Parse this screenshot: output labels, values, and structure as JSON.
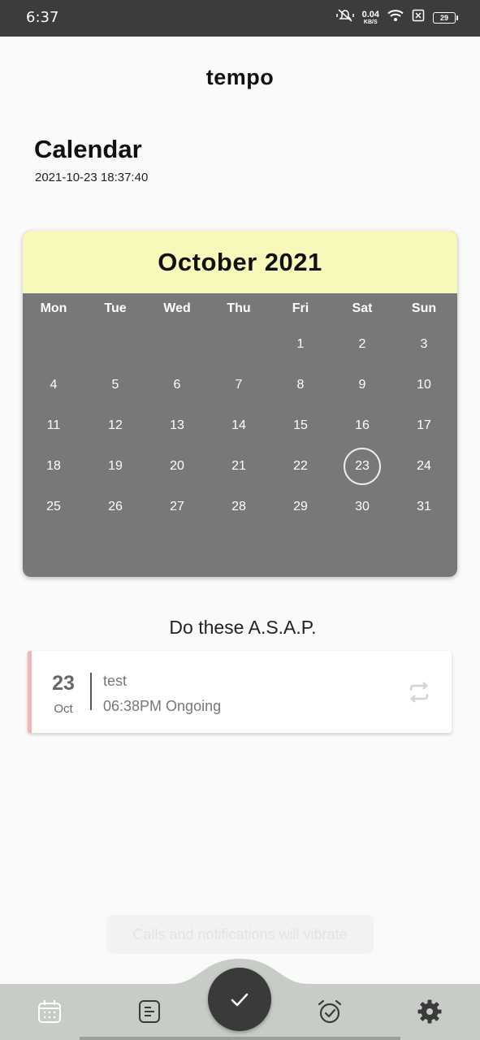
{
  "status_bar": {
    "time": "6:37",
    "net_speed_value": "0.04",
    "net_speed_unit": "KB/S",
    "battery": "29"
  },
  "app": {
    "title": "tempo"
  },
  "page": {
    "heading": "Calendar",
    "timestamp": "2021-10-23 18:37:40"
  },
  "calendar": {
    "month_label": "October 2021",
    "weekdays": [
      "Mon",
      "Tue",
      "Wed",
      "Thu",
      "Fri",
      "Sat",
      "Sun"
    ],
    "weeks": [
      [
        "",
        "",
        "",
        "",
        "1",
        "2",
        "3"
      ],
      [
        "4",
        "5",
        "6",
        "7",
        "8",
        "9",
        "10"
      ],
      [
        "11",
        "12",
        "13",
        "14",
        "15",
        "16",
        "17"
      ],
      [
        "18",
        "19",
        "20",
        "21",
        "22",
        "23",
        "24"
      ],
      [
        "25",
        "26",
        "27",
        "28",
        "29",
        "30",
        "31"
      ]
    ],
    "selected_day": "23",
    "header_color": "#f8f8bb",
    "body_color": "#787878"
  },
  "tasks_section": {
    "title": "Do these A.S.A.P.",
    "tasks": [
      {
        "day": "23",
        "month": "Oct",
        "name": "test",
        "detail": "06:38PM Ongoing",
        "icon": "repeat-icon",
        "accent_color": "#f5b5b5"
      }
    ]
  },
  "toast": {
    "text": "Calls and notifications will vibrate"
  },
  "bottom_nav": {
    "items": [
      "calendar-icon",
      "list-icon",
      "check-icon",
      "alarm-check-icon",
      "settings-icon"
    ],
    "background_color": "#c8ccc6",
    "fab_color": "#3a3a3a"
  }
}
